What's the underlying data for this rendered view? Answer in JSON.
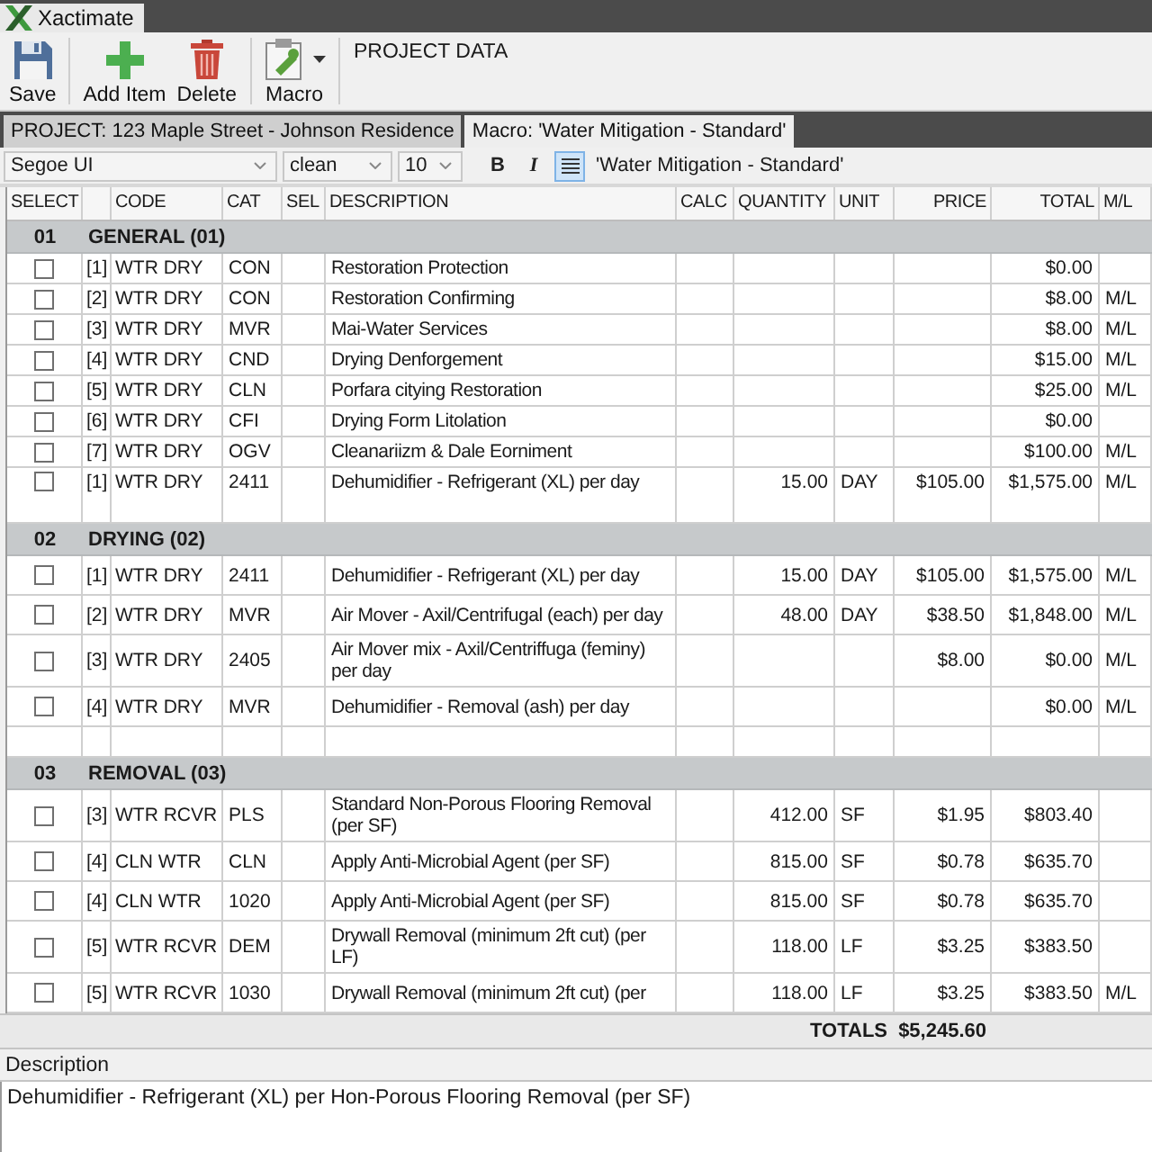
{
  "window": {
    "title": "Xactimate"
  },
  "toolbar": {
    "groups": [
      [
        {
          "kind": "save",
          "label": "Save"
        }
      ],
      [
        {
          "kind": "add",
          "label": "Add Item"
        },
        {
          "kind": "delete",
          "label": "Delete"
        }
      ],
      [
        {
          "kind": "macro",
          "label": "Macro"
        }
      ]
    ],
    "section_label": "PROJECT DATA"
  },
  "tabs": [
    {
      "label": "PROJECT: 123 Maple Street - Johnson Residence",
      "selected": false
    },
    {
      "label": "Macro: 'Water Mitigation - Standard'",
      "selected": true
    }
  ],
  "format_bar": {
    "font": "Segoe UI",
    "style": "clean",
    "size": "10",
    "buttons": [
      {
        "kind": "bold",
        "label": "B",
        "selected": false
      },
      {
        "kind": "italic",
        "label": "I",
        "selected": false
      },
      {
        "kind": "align",
        "selected": true
      }
    ],
    "macro_name": "'Water Mitigation - Standard'"
  },
  "table": {
    "columns": [
      "SELECT",
      "CODE",
      "CAT",
      "SEL",
      "DESCRIPTION",
      "CALC",
      "QUANTITY",
      "UNIT",
      "PRICE",
      "TOTAL",
      "M/L"
    ],
    "groups": [
      {
        "number": "01",
        "title": "GENERAL (01)",
        "rows": [
          {
            "kind": "item",
            "checked": false,
            "index": "[1]",
            "code": "WTR DRY",
            "cat": "CON",
            "description": "Restoration Protection",
            "total": "$0.00"
          },
          {
            "kind": "item",
            "checked": false,
            "index": "[2]",
            "code": "WTR DRY",
            "cat": "CON",
            "description": "Restoration Confirming",
            "total": "$8.00",
            "ml": "M/L"
          },
          {
            "kind": "item",
            "checked": false,
            "index": "[3]",
            "code": "WTR DRY",
            "cat": "MVR",
            "description": "Mai-Water Services",
            "total": "$8.00",
            "ml": "M/L"
          },
          {
            "kind": "item",
            "checked": false,
            "index": "[4]",
            "code": "WTR DRY",
            "cat": "CND",
            "description": "Drying Denforgement",
            "total": "$15.00",
            "ml": "M/L"
          },
          {
            "kind": "item",
            "checked": false,
            "index": "[5]",
            "code": "WTR DRY",
            "cat": "CLN",
            "description": "Porfara citying Restoration",
            "total": "$25.00",
            "ml": "M/L"
          },
          {
            "kind": "item",
            "checked": false,
            "index": "[6]",
            "code": "WTR DRY",
            "cat": "CFI",
            "description": "Drying Form Litolation",
            "total": "$0.00"
          },
          {
            "kind": "item",
            "checked": false,
            "index": "[7]",
            "code": "WTR DRY",
            "cat": "OGV",
            "description": "Cleanariizm & Dale Eorniment",
            "total": "$100.00",
            "ml": "M/L"
          },
          {
            "kind": "item",
            "checked": false,
            "index": "[1]",
            "code": "WTR DRY",
            "cat": "2411",
            "description": "Dehumidifier - Refrigerant (XL) per day",
            "quantity": "15.00",
            "unit": "DAY",
            "price": "$105.00",
            "total": "$1,575.00",
            "ml": "M/L"
          }
        ]
      },
      {
        "number": "02",
        "title": "DRYING (02)",
        "rows": [
          {
            "kind": "item",
            "checked": false,
            "index": "[1]",
            "code": "WTR DRY",
            "cat": "2411",
            "description": "Dehumidifier - Refrigerant (XL) per day",
            "quantity": "15.00",
            "unit": "DAY",
            "price": "$105.00",
            "total": "$1,575.00",
            "ml": "M/L"
          },
          {
            "kind": "item",
            "checked": false,
            "index": "[2]",
            "code": "WTR DRY",
            "cat": "MVR",
            "description": "Air Mover - Axil/Centrifugal (each) per day",
            "quantity": "48.00",
            "unit": "DAY",
            "price": "$38.50",
            "total": "$1,848.00",
            "ml": "M/L"
          },
          {
            "kind": "item",
            "checked": false,
            "index": "[3]",
            "code": "WTR DRY",
            "cat": "2405",
            "description": "Air Mover mix - Axil/Centriffuga (feminy) per day",
            "price": "$8.00",
            "total": "$0.00",
            "ml": "M/L"
          },
          {
            "kind": "item",
            "checked": false,
            "index": "[4]",
            "code": "WTR DRY",
            "cat": "MVR",
            "description": "Dehumidifier - Removal (ash) per day",
            "total": "$0.00",
            "ml": "M/L"
          },
          {
            "kind": "blank"
          }
        ]
      },
      {
        "number": "03",
        "title": "REMOVAL (03)",
        "rows": [
          {
            "kind": "item",
            "checked": false,
            "index": "[3]",
            "code": "WTR RCVR",
            "cat": "PLS",
            "description": "Standard Non-Porous Flooring Removal (per SF)",
            "quantity": "412.00",
            "unit": "SF",
            "price": "$1.95",
            "total": "$803.40"
          },
          {
            "kind": "item",
            "checked": false,
            "index": "[4]",
            "code": "CLN WTR",
            "cat": "CLN",
            "description": "Apply Anti-Microbial Agent (per SF)",
            "quantity": "815.00",
            "unit": "SF",
            "price": "$0.78",
            "total": "$635.70"
          },
          {
            "kind": "item",
            "checked": false,
            "index": "[4]",
            "code": "CLN WTR",
            "cat": "1020",
            "description": "Apply Anti-Microbial Agent (per SF)",
            "quantity": "815.00",
            "unit": "SF",
            "price": "$0.78",
            "total": "$635.70"
          },
          {
            "kind": "item",
            "checked": false,
            "index": "[5]",
            "code": "WTR RCVR",
            "cat": "DEM",
            "description": "Drywall Removal (minimum 2ft cut) (per LF)",
            "quantity": "118.00",
            "unit": "LF",
            "price": "$3.25",
            "total": "$383.50"
          },
          {
            "kind": "item",
            "checked": false,
            "index": "[5]",
            "code": "WTR RCVR",
            "cat": "1030",
            "description": "Drywall Removal (minimum 2ft cut) (per",
            "quantity": "118.00",
            "unit": "LF",
            "price": "$3.25",
            "total": "$383.50",
            "ml": "M/L"
          }
        ]
      }
    ]
  },
  "totals": {
    "label": "TOTALS",
    "value": "$5,245.60"
  },
  "description_panel": {
    "label": "Description",
    "text": "Dehumidifier - Refrigerant (XL) per Hon-Porous Flooring Removal (per SF)"
  }
}
